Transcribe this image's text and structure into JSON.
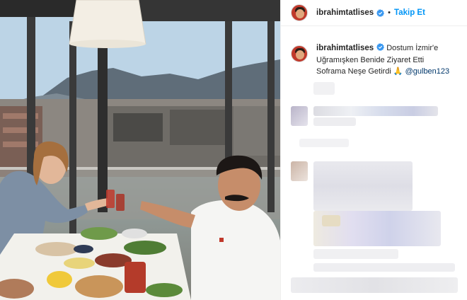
{
  "post": {
    "username": "ibrahimtatlises",
    "follow_label": "Takip Et",
    "more_label": "···",
    "caption": {
      "line1": "Dostum İzmir'e",
      "line2": "Uğramışken Benide Ziyaret Etti",
      "line3": "Soframa Neşe Getirdi",
      "emoji": "🙏",
      "mention": "@gulben123"
    }
  },
  "colors": {
    "follow": "#0095f6",
    "verified": "#3897f0",
    "mention": "#00376b"
  },
  "icons": [
    "verified-badge-icon",
    "more-options-icon",
    "praying-hands-icon"
  ]
}
